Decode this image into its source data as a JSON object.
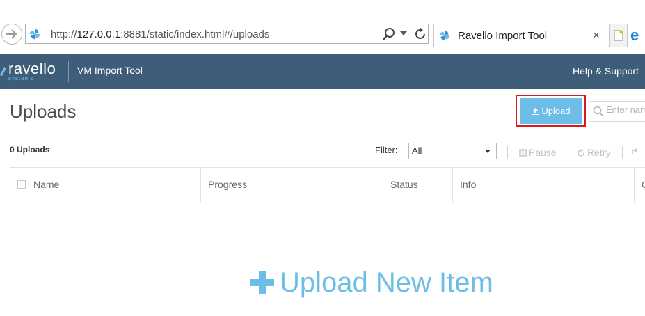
{
  "browser": {
    "url_prefix": "http://",
    "url_host": "127.0.0.1",
    "url_rest": ":8881/static/index.html#/uploads",
    "tab_title": "Ravello Import Tool",
    "tab_close": "×"
  },
  "appbar": {
    "logo_word": "ravello",
    "logo_sub": "systems",
    "title": "VM Import Tool",
    "help": "Help & Support"
  },
  "page": {
    "title": "Uploads",
    "upload_button": "Upload",
    "search_placeholder": "Enter name"
  },
  "toolbar": {
    "count": "0 Uploads",
    "filter_label": "Filter:",
    "filter_value": "All",
    "pause": "Pause",
    "retry": "Retry"
  },
  "table": {
    "columns": [
      "Name",
      "Progress",
      "Status",
      "Info",
      "C"
    ]
  },
  "empty_state": {
    "label": "Upload New Item"
  },
  "colors": {
    "appbar": "#3d5d79",
    "accent": "#6cbde8",
    "highlight": "#d9191c"
  }
}
